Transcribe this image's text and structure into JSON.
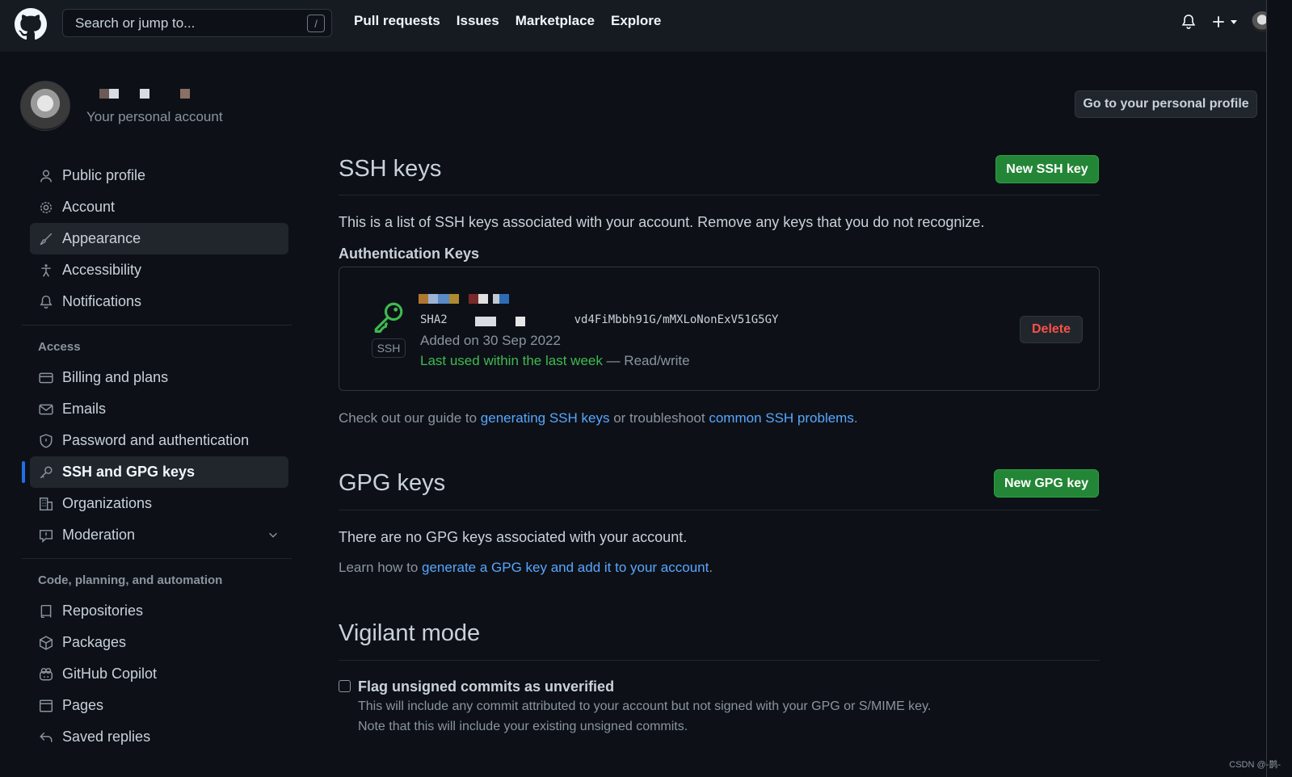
{
  "header": {
    "search_placeholder": "Search or jump to...",
    "search_shortcut": "/",
    "nav": [
      "Pull requests",
      "Issues",
      "Marketplace",
      "Explore"
    ]
  },
  "profile": {
    "subtitle": "Your personal account",
    "goto_button": "Go to your personal profile"
  },
  "sidebar": {
    "items": [
      {
        "label": "Public profile",
        "icon": "person-icon"
      },
      {
        "label": "Account",
        "icon": "gear-icon"
      },
      {
        "label": "Appearance",
        "icon": "paintbrush-icon"
      },
      {
        "label": "Accessibility",
        "icon": "accessibility-icon"
      },
      {
        "label": "Notifications",
        "icon": "bell-icon"
      }
    ],
    "access_label": "Access",
    "access_items": [
      {
        "label": "Billing and plans",
        "icon": "credit-card-icon"
      },
      {
        "label": "Emails",
        "icon": "mail-icon"
      },
      {
        "label": "Password and authentication",
        "icon": "shield-icon"
      },
      {
        "label": "SSH and GPG keys",
        "icon": "key-icon"
      },
      {
        "label": "Organizations",
        "icon": "organization-icon"
      },
      {
        "label": "Moderation",
        "icon": "report-icon"
      }
    ],
    "code_label": "Code, planning, and automation",
    "code_items": [
      {
        "label": "Repositories",
        "icon": "repo-icon"
      },
      {
        "label": "Packages",
        "icon": "package-icon"
      },
      {
        "label": "GitHub Copilot",
        "icon": "copilot-icon"
      },
      {
        "label": "Pages",
        "icon": "browser-icon"
      },
      {
        "label": "Saved replies",
        "icon": "reply-icon"
      }
    ]
  },
  "ssh": {
    "title": "SSH keys",
    "new_button": "New SSH key",
    "description": "This is a list of SSH keys associated with your account. Remove any keys that you do not recognize.",
    "auth_heading": "Authentication Keys",
    "key": {
      "badge": "SSH",
      "fingerprint_prefix": "SHA2",
      "fingerprint_suffix": "vd4FiMbbh91G/mMXLoNonExV51G5GY",
      "added": "Added on 30 Sep 2022",
      "last_used": "Last used within the last week",
      "access": " — Read/write",
      "delete_button": "Delete"
    },
    "guide_prefix": "Check out our guide to ",
    "guide_link1": "generating SSH keys",
    "guide_middle": " or troubleshoot ",
    "guide_link2": "common SSH problems",
    "guide_suffix": "."
  },
  "gpg": {
    "title": "GPG keys",
    "new_button": "New GPG key",
    "empty": "There are no GPG keys associated with your account.",
    "learn_prefix": "Learn how to ",
    "learn_link": "generate a GPG key and add it to your account",
    "learn_suffix": "."
  },
  "vigilant": {
    "title": "Vigilant mode",
    "checkbox_label": "Flag unsigned commits as unverified",
    "help1": "This will include any commit attributed to your account but not signed with your GPG or S/MIME key.",
    "help2": "Note that this will include your existing unsigned commits."
  },
  "watermark": "CSDN @-鹊-",
  "colors": {
    "accent_blue": "#58a6ff",
    "green_button": "#238636",
    "danger": "#f85149",
    "success_text": "#3fb950"
  }
}
